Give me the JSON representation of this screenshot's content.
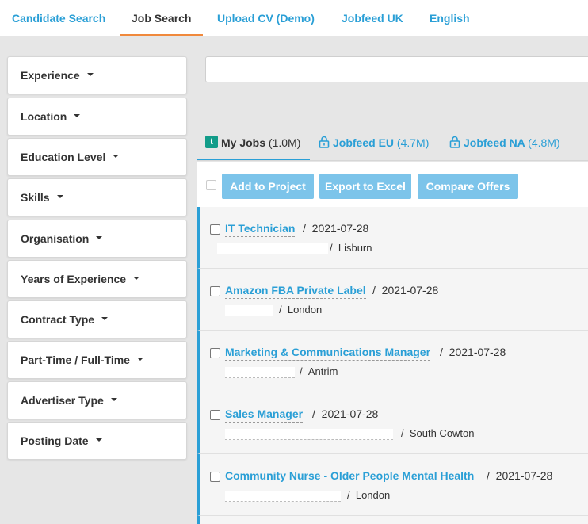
{
  "nav": {
    "tabs": [
      {
        "label": "Candidate Search"
      },
      {
        "label": "Job Search"
      },
      {
        "label": "Upload CV (Demo)"
      },
      {
        "label": "Jobfeed UK"
      },
      {
        "label": "English"
      }
    ],
    "active_tab": "Job Search"
  },
  "filters": [
    {
      "label": "Experience"
    },
    {
      "label": "Location"
    },
    {
      "label": "Education Level"
    },
    {
      "label": "Skills"
    },
    {
      "label": "Organisation"
    },
    {
      "label": "Years of Experience"
    },
    {
      "label": "Contract Type"
    },
    {
      "label": "Part-Time / Full-Time"
    },
    {
      "label": "Advertiser Type"
    },
    {
      "label": "Posting Date"
    }
  ],
  "search": {
    "value": "",
    "placeholder": ""
  },
  "sources": [
    {
      "icon": "t-logo-icon",
      "label": "My Jobs",
      "count": "(1.0M)",
      "active": true
    },
    {
      "icon": "lock-icon",
      "label": "Jobfeed EU",
      "count": "(4.7M)",
      "active": false
    },
    {
      "icon": "lock-icon",
      "label": "Jobfeed NA",
      "count": "(4.8M)",
      "active": false
    }
  ],
  "actions": {
    "add_to_project": "Add to Project",
    "export_to_excel": "Export to Excel",
    "compare_offers": "Compare Offers"
  },
  "jobs": [
    {
      "title": "IT Technician",
      "date": "2021-07-28",
      "location": "Lisburn"
    },
    {
      "title": "Amazon FBA Private Label",
      "date": "2021-07-28",
      "location": "London"
    },
    {
      "title": "Marketing & Communications Manager",
      "date": "2021-07-28",
      "location": "Antrim"
    },
    {
      "title": "Sales Manager",
      "date": "2021-07-28",
      "location": "South Cowton"
    },
    {
      "title": "Community Nurse - Older People Mental Health",
      "date": "2021-07-28",
      "location": "London"
    }
  ],
  "colors": {
    "accent": "#2a9fd6",
    "active_tab_underline": "#f0893c",
    "button_bg": "#7cc4ea",
    "brand_t": "#129c89"
  }
}
